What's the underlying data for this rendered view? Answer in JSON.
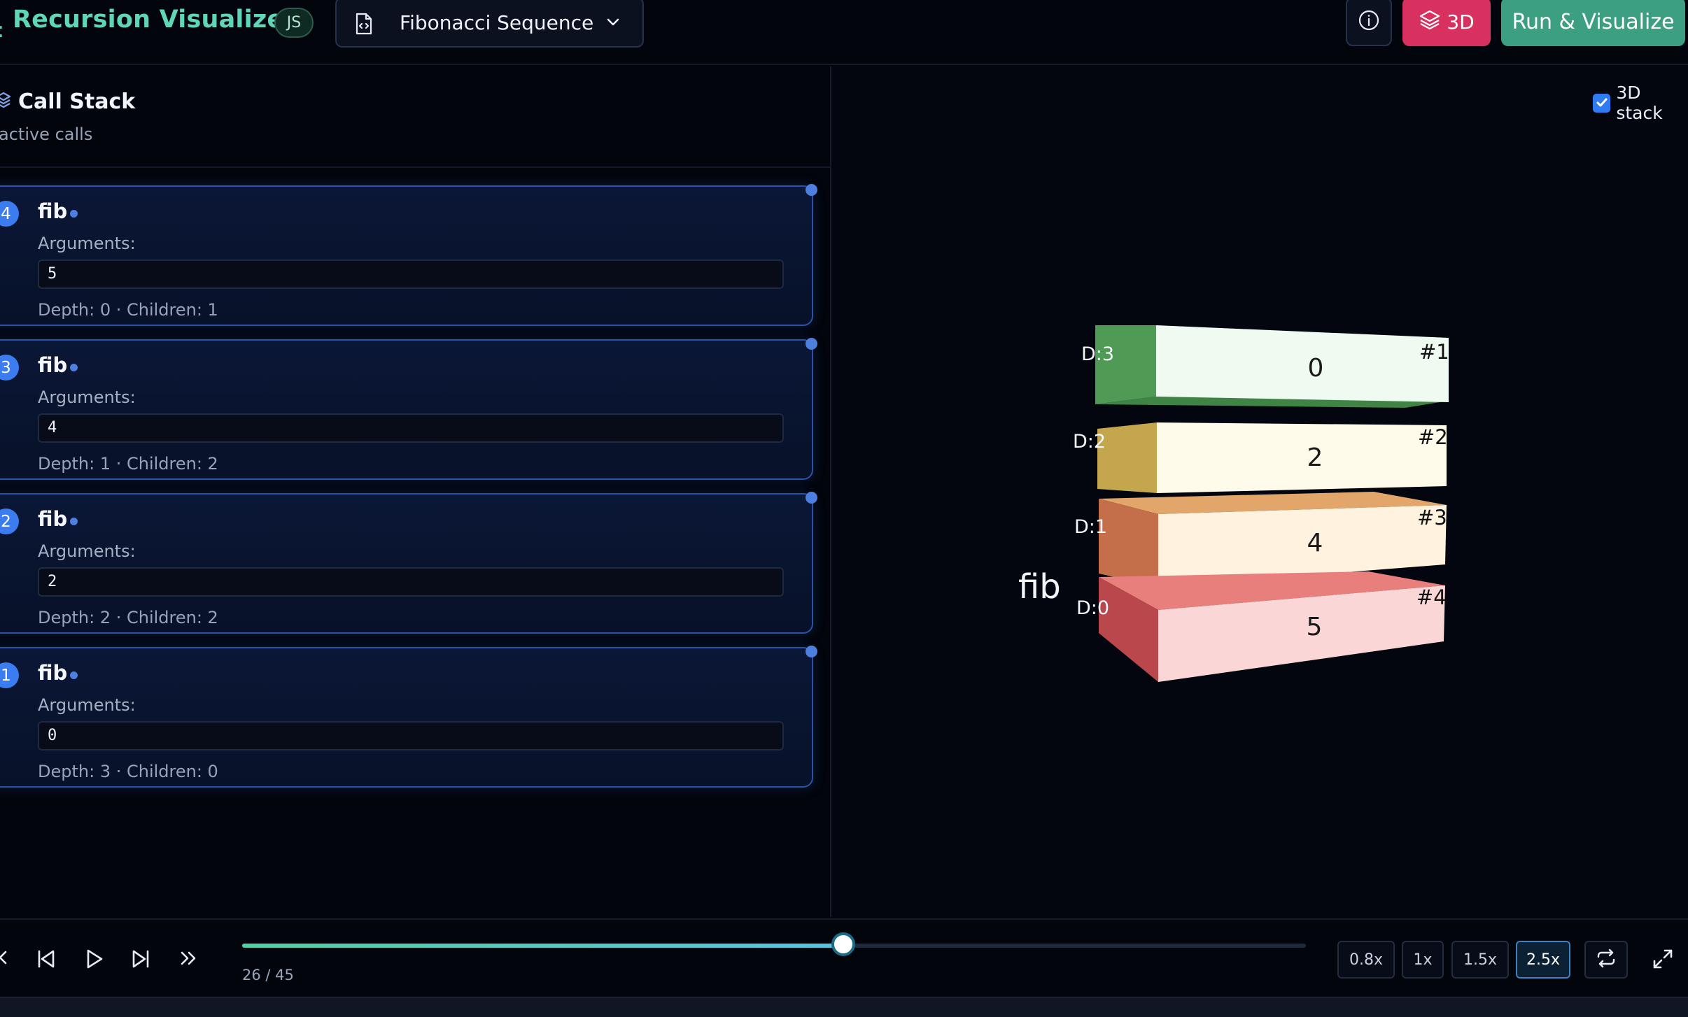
{
  "header": {
    "title": "Recursion Visualizer",
    "language_badge": "JS",
    "algorithm_select": "Fibonacci Sequence",
    "btn_3d": "3D",
    "btn_run": "Run & Visualize"
  },
  "call_stack": {
    "title": "Call Stack",
    "subtitle": "active calls",
    "args_label": "Arguments:",
    "frames": [
      {
        "index": "4",
        "fn": "fib",
        "args": "5",
        "meta": "Depth: 0 · Children: 1"
      },
      {
        "index": "3",
        "fn": "fib",
        "args": "4",
        "meta": "Depth: 1 · Children: 2"
      },
      {
        "index": "2",
        "fn": "fib",
        "args": "2",
        "meta": "Depth: 2 · Children: 2"
      },
      {
        "index": "1",
        "fn": "fib",
        "args": "0",
        "meta": "Depth: 3 · Children: 0"
      }
    ]
  },
  "scene": {
    "toggle_label": "3D stack",
    "toggle_checked": true,
    "fn_label": "fib",
    "blocks": [
      {
        "depth": "D:3",
        "value": "0",
        "id": "#1",
        "color": "#4f9a55"
      },
      {
        "depth": "D:2",
        "value": "2",
        "id": "#2",
        "color": "#c9a94f"
      },
      {
        "depth": "D:1",
        "value": "4",
        "id": "#3",
        "color": "#d98a55"
      },
      {
        "depth": "D:0",
        "value": "5",
        "id": "#4",
        "color": "#d45a5e"
      }
    ]
  },
  "player": {
    "step_label": "26 / 45",
    "progress": 0.5652,
    "speeds": [
      "0.8x",
      "1x",
      "1.5x",
      "2.5x"
    ],
    "active_speed": "2.5x"
  },
  "colors": {
    "accent_teal": "#5fd6b6",
    "accent_pink": "#d8305f",
    "accent_green": "#3d9f82",
    "card_border": "#2b52a8",
    "badge_blue": "#3b7cf0"
  }
}
